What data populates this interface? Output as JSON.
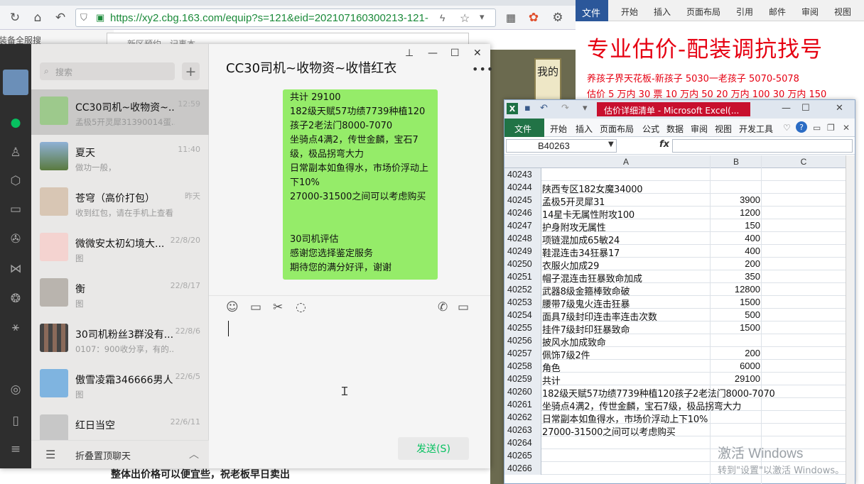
{
  "browser": {
    "url": "https://xy2.cbg.163.com/equip?s=121&eid=202107160300213-121-",
    "bookmark": "装备全服搜"
  },
  "notepad": {
    "title": "新区预约 - 记事本",
    "bottom_text": "整体出价格可以便宜些，祝老板早日卖出"
  },
  "game": {
    "box_text": "我的"
  },
  "wechat": {
    "search_placeholder": "搜索",
    "plus": "+",
    "chats": [
      {
        "name": "CC30司机~收物资~...",
        "preview": "孟极5开灵犀31390014蛋...",
        "time": "12:59"
      },
      {
        "name": "夏天",
        "preview": "做功一般，",
        "time": "11:40"
      },
      {
        "name": "苍穹（高价打包）",
        "preview": "收到红包，请在手机上查看",
        "time": "昨天"
      },
      {
        "name": "微微安太初幻境大...",
        "preview": "图",
        "time": "22/8/20"
      },
      {
        "name": "衡",
        "preview": "图",
        "time": "22/8/17"
      },
      {
        "name": "30司机粉丝3群没有...",
        "preview": "0107：900收分享，有的...",
        "time": "22/8/6"
      },
      {
        "name": "傲雪凌霜346666男人",
        "preview": "图",
        "time": "22/6/5"
      },
      {
        "name": "红日当空",
        "preview": "",
        "time": "22/6/11"
      }
    ],
    "fold_label": "折叠置顶聊天",
    "chat_title": "CC30司机~收物资~收惜红衣",
    "more": "•••",
    "bubble_lines": [
      "共计 29100",
      "182级天赋57功绩7739种植120孩子2老法门8000-7070",
      "坐骑点4满2，传世金麟，宝石7级，极品拐弯大力",
      "日常副本如鱼得水，市场价浮动上下10%",
      "27000-31500之间可以考虑购买"
    ],
    "bubble_footer": [
      "30司机评估",
      "感谢您选择鉴定服务",
      "期待您的满分好评，谢谢"
    ],
    "send_label": "发送(S)"
  },
  "word": {
    "file": "文件",
    "menus": [
      "开始",
      "插入",
      "页面布局",
      "引用",
      "邮件",
      "审阅",
      "视图"
    ],
    "heading": "专业估价-配装调抗找号",
    "line1": "养孩子界天花板-新孩子 5030一老孩子 5070-5078",
    "line2": "估价 5 万内 30 票   10 万内 50  20 万内 100  30 万内 150"
  },
  "excel": {
    "caption": "估价详细清单 - Microsoft Excel(...",
    "file": "文件",
    "menus": [
      "开始",
      "插入",
      "页面布局",
      "公式",
      "数据",
      "审阅",
      "视图",
      "开发工具"
    ],
    "name_box": "B40263",
    "fx": "fx",
    "columns": [
      "A",
      "B",
      "C"
    ],
    "rows": [
      {
        "n": "40243",
        "a": "",
        "b": ""
      },
      {
        "n": "40244",
        "a": "陕西专区182女魔34000",
        "b": ""
      },
      {
        "n": "40245",
        "a": "孟极5开灵犀31",
        "b": "3900"
      },
      {
        "n": "40246",
        "a": "14星卡无属性附攻100",
        "b": "1200"
      },
      {
        "n": "40247",
        "a": "护身附攻无属性",
        "b": "150"
      },
      {
        "n": "40248",
        "a": "项链混加成65敏24",
        "b": "400"
      },
      {
        "n": "40249",
        "a": "鞋混连击34狂暴17",
        "b": "400"
      },
      {
        "n": "40250",
        "a": "衣服火加成29",
        "b": "200"
      },
      {
        "n": "40251",
        "a": "帽子混连击狂暴致命加成",
        "b": "350"
      },
      {
        "n": "40252",
        "a": "武器8级金箍棒致命破",
        "b": "12800"
      },
      {
        "n": "40253",
        "a": "腰带7级鬼火连击狂暴",
        "b": "1500"
      },
      {
        "n": "40254",
        "a": "面具7级封印连击率连击次数",
        "b": "500"
      },
      {
        "n": "40255",
        "a": "挂件7级封印狂暴致命",
        "b": "1500"
      },
      {
        "n": "40256",
        "a": "披风水加成致命",
        "b": ""
      },
      {
        "n": "40257",
        "a": "佩饰7级2件",
        "b": "200"
      },
      {
        "n": "40258",
        "a": "角色",
        "b": "6000"
      },
      {
        "n": "40259",
        "a": "共计",
        "b": "29100"
      },
      {
        "n": "40260",
        "a": "182级天赋57功绩7739种植120孩子2老法门8000-7070",
        "b": ""
      },
      {
        "n": "40261",
        "a": "坐骑点4满2，传世金麟，宝石7级，极品拐弯大力",
        "b": ""
      },
      {
        "n": "40262",
        "a": "日常副本如鱼得水，市场价浮动上下10%",
        "b": ""
      },
      {
        "n": "40263",
        "a": "27000-31500之间可以考虑购买",
        "b": ""
      },
      {
        "n": "40264",
        "a": "",
        "b": ""
      },
      {
        "n": "40265",
        "a": "",
        "b": ""
      },
      {
        "n": "40266",
        "a": "",
        "b": ""
      }
    ]
  },
  "watermark": {
    "line1": "激活 Windows",
    "line2": "转到\"设置\"以激活 Windows。"
  },
  "colors": {
    "wechat_green": "#95ec69",
    "send_green": "#07c160",
    "word_blue": "#2b579a",
    "excel_green": "#217346",
    "red": "#e60012"
  }
}
